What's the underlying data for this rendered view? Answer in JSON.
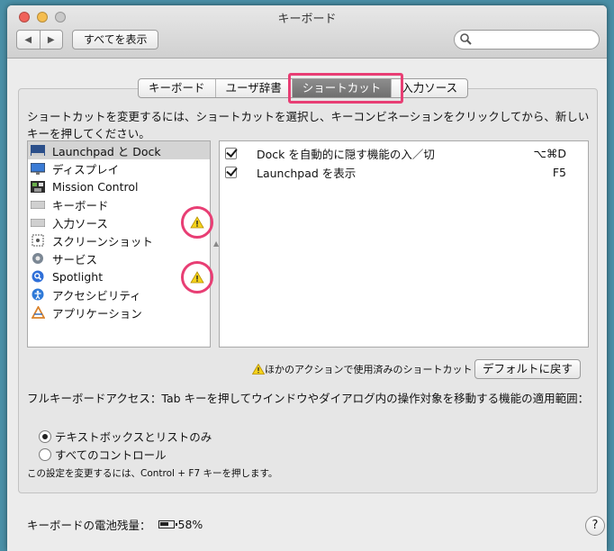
{
  "window": {
    "title": "キーボード"
  },
  "toolbar": {
    "back": "◀",
    "forward": "▶",
    "show_all": "すべてを表示",
    "search_placeholder": ""
  },
  "tabs": [
    "キーボード",
    "ユーザ辞書",
    "ショートカット",
    "入力ソース"
  ],
  "instructions": "ショートカットを変更するには、ショートカットを選択し、キーコンビネーションをクリックしてから、新しいキーを押してください。",
  "categories": [
    {
      "label": "Launchpad と Dock",
      "icon": "launchpad-dock-icon",
      "selected": true
    },
    {
      "label": "ディスプレイ",
      "icon": "display-icon"
    },
    {
      "label": "Mission Control",
      "icon": "mission-control-icon"
    },
    {
      "label": "キーボード",
      "icon": "keyboard-icon"
    },
    {
      "label": "入力ソース",
      "icon": "keyboard-icon",
      "warning": true
    },
    {
      "label": "スクリーンショット",
      "icon": "screenshot-icon"
    },
    {
      "label": "サービス",
      "icon": "gear-icon"
    },
    {
      "label": "Spotlight",
      "icon": "spotlight-icon",
      "warning": true
    },
    {
      "label": "アクセシビリティ",
      "icon": "accessibility-icon"
    },
    {
      "label": "アプリケーション",
      "icon": "app-store-icon"
    }
  ],
  "shortcuts": [
    {
      "label": "Dock を自動的に隠す機能の入／切",
      "key": "⌥⌘D",
      "checked": true
    },
    {
      "label": "Launchpad を表示",
      "key": "F5",
      "checked": true
    }
  ],
  "conflict_note": "ほかのアクションで使用済みのショートカット",
  "defaults_button": "デフォルトに戻す",
  "full_keyboard_access": "フルキーボードアクセス：Tab キーを押してウインドウやダイアログ内の操作対象を移動する機能の適用範囲：",
  "radio_options": [
    {
      "label": "テキストボックスとリストのみ",
      "selected": true
    },
    {
      "label": "すべてのコントロール",
      "selected": false
    }
  ],
  "settings_note": "この設定を変更するには、Control + F7 キーを押します。",
  "battery": {
    "label": "キーボードの電池残量：",
    "percent": "58%"
  },
  "help": "?",
  "colors": {
    "highlight": "#e83e74",
    "selected_row": "#d4d4d4",
    "warning": "#f5d21b"
  }
}
